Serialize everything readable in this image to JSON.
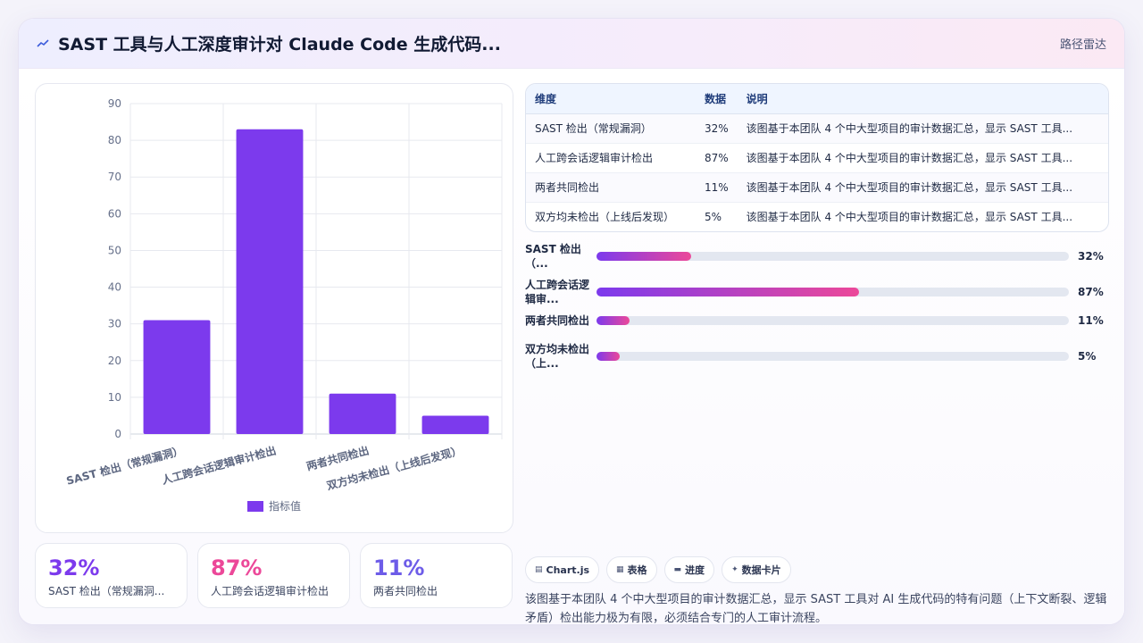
{
  "header": {
    "title": "SAST 工具与人工深度审计对 Claude Code 生成代码...",
    "tag": "路径雷达"
  },
  "chart_data": {
    "type": "bar",
    "categories": [
      "SAST 检出（常规漏洞）",
      "人工跨会话逻辑审计检出",
      "两者共同检出",
      "双方均未检出（上线后发现）"
    ],
    "series": [
      {
        "name": "指标值",
        "values": [
          31,
          83,
          11,
          5
        ]
      }
    ],
    "ylim": [
      0,
      90
    ],
    "yticks": [
      0,
      10,
      20,
      30,
      40,
      50,
      60,
      70,
      80,
      90
    ],
    "grid": true,
    "legend": "bottom",
    "color": "#7c3aed"
  },
  "table": {
    "headers": [
      "维度",
      "数据",
      "说明"
    ],
    "rows": [
      [
        "SAST 检出（常规漏洞）",
        "32%",
        "该图基于本团队 4 个中大型项目的审计数据汇总，显示 SAST 工具..."
      ],
      [
        "人工跨会话逻辑审计检出",
        "87%",
        "该图基于本团队 4 个中大型项目的审计数据汇总，显示 SAST 工具..."
      ],
      [
        "两者共同检出",
        "11%",
        "该图基于本团队 4 个中大型项目的审计数据汇总，显示 SAST 工具..."
      ],
      [
        "双方均未检出（上线后发现）",
        "5%",
        "该图基于本团队 4 个中大型项目的审计数据汇总，显示 SAST 工具..."
      ]
    ]
  },
  "progress": [
    {
      "label": "SAST 检出（...",
      "value": "32%",
      "fraction": 0.2
    },
    {
      "label": "人工跨会话逻辑审...",
      "value": "87%",
      "fraction": 0.555
    },
    {
      "label": "两者共同检出",
      "value": "11%",
      "fraction": 0.07
    },
    {
      "label": "双方均未检出（上...",
      "value": "5%",
      "fraction": 0.05
    }
  ],
  "stats": [
    {
      "value": "32%",
      "label": "SAST 检出（常规漏洞...",
      "color": "#7c3aed"
    },
    {
      "value": "87%",
      "label": "人工跨会话逻辑审计检出",
      "color": "#ec4899"
    },
    {
      "value": "11%",
      "label": "两者共同检出",
      "color": "#6d5ce8"
    }
  ],
  "chips": [
    {
      "icon": "▤",
      "label": "Chart.js"
    },
    {
      "icon": "▦",
      "label": "表格"
    },
    {
      "icon": "▬",
      "label": "进度"
    },
    {
      "icon": "✦",
      "label": "数据卡片"
    }
  ],
  "description": "该图基于本团队 4 个中大型项目的审计数据汇总，显示 SAST 工具对 AI 生成代码的特有问题（上下文断裂、逻辑矛盾）检出能力极为有限，必须结合专门的人工审计流程。"
}
